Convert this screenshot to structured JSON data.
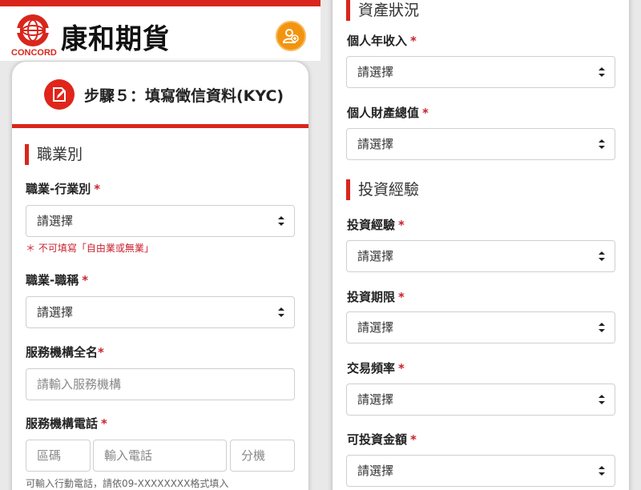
{
  "brand": {
    "logo_text": "CONCORD",
    "name": "康和期貨",
    "color": "#d9261c"
  },
  "header": {
    "user_icon": "user-group-icon",
    "user_color": "#f29410"
  },
  "step": {
    "icon": "edit-document-icon",
    "title": "步驟５：填寫徵信資料(KYC)"
  },
  "occupation": {
    "section_title": "職業別",
    "industry": {
      "label": "職業-行業別",
      "required": "*",
      "value": "請選擇",
      "note": "＊ 不可填寫「自由業或無業」"
    },
    "job_title": {
      "label": "職業-職稱",
      "required": "*",
      "value": "請選擇"
    },
    "institution": {
      "label": "服務機構全名",
      "required": "*",
      "placeholder": "請輸入服務機構"
    },
    "phone": {
      "label": "服務機構電話",
      "required": "*",
      "area_placeholder": "區碼",
      "number_placeholder": "輸入電話",
      "ext_placeholder": "分機",
      "note": "可輸入行動電話，請依09-XXXXXXXX格式填入"
    }
  },
  "assets": {
    "section_title": "資產狀況",
    "annual_income": {
      "label": "個人年收入",
      "required": "*",
      "value": "請選擇"
    },
    "total_assets": {
      "label": "個人財產總值",
      "required": "*",
      "value": "請選擇"
    }
  },
  "investment": {
    "section_title": "投資經驗",
    "experience": {
      "label": "投資經驗",
      "required": "*",
      "value": "請選擇"
    },
    "period": {
      "label": "投資期限",
      "required": "*",
      "value": "請選擇"
    },
    "frequency": {
      "label": "交易頻率",
      "required": "*",
      "value": "請選擇"
    },
    "amount": {
      "label": "可投資金額",
      "required": "*",
      "value": "請選擇"
    }
  }
}
